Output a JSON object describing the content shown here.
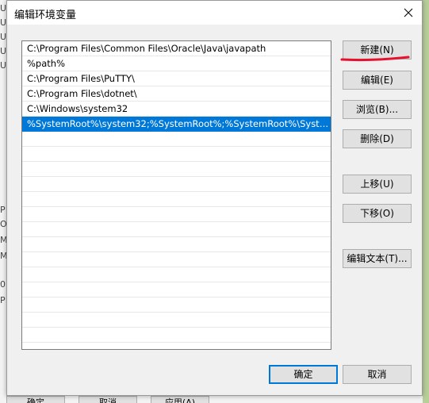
{
  "dialog": {
    "title": "编辑环境变量",
    "close_icon": "close-icon"
  },
  "path_list": {
    "items": [
      "C:\\Program Files\\Common Files\\Oracle\\Java\\javapath",
      "%path%",
      "C:\\Program Files\\PuTTY\\",
      "C:\\Program Files\\dotnet\\",
      "C:\\Windows\\system32",
      "%SystemRoot%\\system32;%SystemRoot%;%SystemRoot%\\System32\\..."
    ],
    "selected_index": 5
  },
  "buttons": {
    "new": "新建(N)",
    "edit": "编辑(E)",
    "browse": "浏览(B)...",
    "delete": "删除(D)",
    "move_up": "上移(U)",
    "move_down": "下移(O)",
    "edit_text": "编辑文本(T)...",
    "ok": "确定",
    "cancel": "取消"
  },
  "background_window": {
    "left_glyphs": [
      "U",
      "U",
      "U",
      "U",
      "U",
      "P",
      "O",
      "M",
      "M",
      "0",
      "P"
    ],
    "bottom_buttons": [
      "确定",
      "取消",
      "应用(A)"
    ]
  },
  "colors": {
    "selection": "#0078d7",
    "annotation": "#e8112d"
  }
}
